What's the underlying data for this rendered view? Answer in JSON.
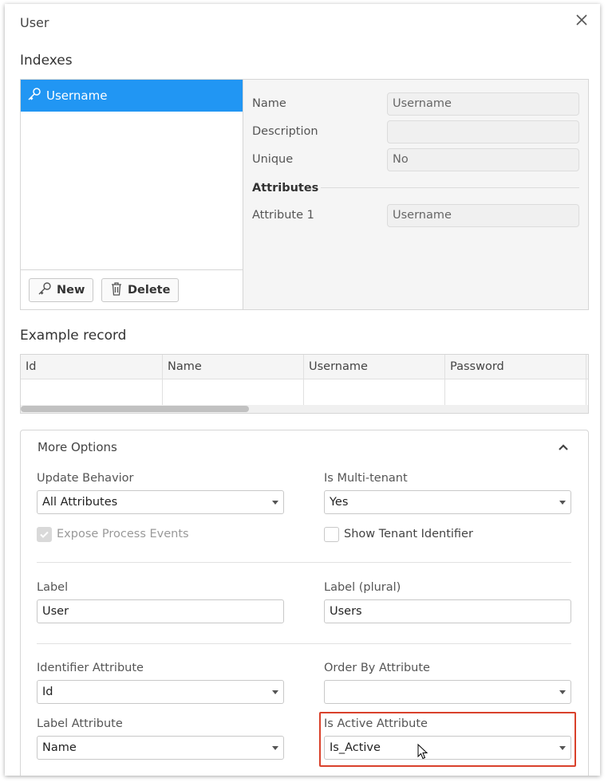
{
  "dialog": {
    "title": "User"
  },
  "indexes": {
    "heading": "Indexes",
    "items": [
      {
        "label": "Username",
        "selected": true
      }
    ],
    "buttons": {
      "new": "New",
      "delete": "Delete"
    },
    "properties": {
      "name_label": "Name",
      "name_value": "Username",
      "description_label": "Description",
      "description_value": "",
      "unique_label": "Unique",
      "unique_value": "No",
      "attributes_heading": "Attributes",
      "attribute1_label": "Attribute 1",
      "attribute1_value": "Username"
    }
  },
  "example_record": {
    "heading": "Example record",
    "columns": [
      "Id",
      "Name",
      "Username",
      "Password"
    ]
  },
  "more_options": {
    "title": "More Options",
    "update_behavior": {
      "label": "Update Behavior",
      "value": "All Attributes"
    },
    "multi_tenant": {
      "label": "Is Multi-tenant",
      "value": "Yes"
    },
    "expose_events": {
      "label": "Expose Process Events",
      "checked": true,
      "disabled": true
    },
    "show_tenant": {
      "label": "Show Tenant Identifier",
      "checked": false
    },
    "label": {
      "label": "Label",
      "value": "User"
    },
    "label_plural": {
      "label": "Label (plural)",
      "value": "Users"
    },
    "identifier_attr": {
      "label": "Identifier Attribute",
      "value": "Id"
    },
    "order_by_attr": {
      "label": "Order By Attribute",
      "value": ""
    },
    "label_attr": {
      "label": "Label Attribute",
      "value": "Name"
    },
    "is_active_attr": {
      "label": "Is Active Attribute",
      "value": "Is_Active"
    }
  },
  "colors": {
    "accent": "#2196f3",
    "highlight": "#d9412b"
  }
}
